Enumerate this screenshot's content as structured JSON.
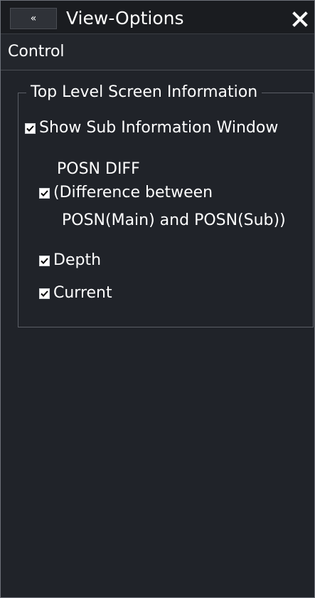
{
  "window": {
    "back_icon": "double-chevron-left-icon",
    "back_glyph": "«",
    "title": "View-Options",
    "close_icon": "close-icon"
  },
  "section": {
    "title": "Control"
  },
  "group": {
    "title": "Top Level Screen Information",
    "show_sub_window": {
      "label": "Show Sub Information Window",
      "checked": true
    },
    "posn_diff": {
      "heading": "POSN DIFF",
      "line1": "(Difference between",
      "line2": "POSN(Main) and POSN(Sub))",
      "checked": true
    },
    "depth": {
      "label": "Depth",
      "checked": true
    },
    "current": {
      "label": "Current",
      "checked": true
    }
  }
}
